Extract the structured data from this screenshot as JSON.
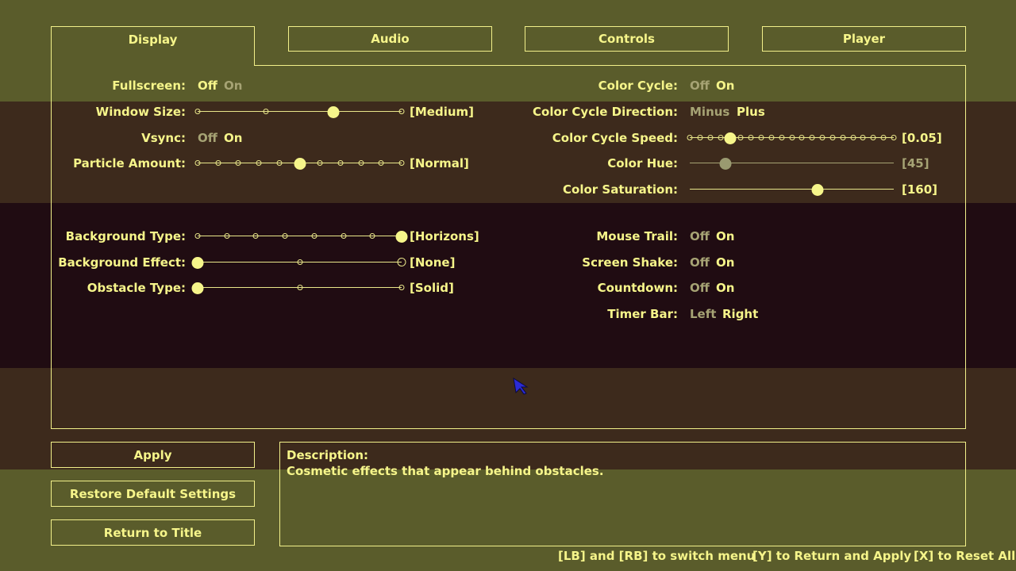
{
  "tabs": [
    "Display",
    "Audio",
    "Controls",
    "Player"
  ],
  "left": {
    "fullscreen": {
      "label": "Fullscreen:",
      "off": "Off",
      "on": "On",
      "selected": "off"
    },
    "window_size": {
      "label": "Window Size:",
      "value": "[Medium]",
      "positions": 4,
      "index": 2
    },
    "vsync": {
      "label": "Vsync:",
      "off": "Off",
      "on": "On",
      "selected": "on"
    },
    "particle_amount": {
      "label": "Particle Amount:",
      "value": "[Normal]",
      "positions": 11,
      "index": 5
    },
    "background_type": {
      "label": "Background Type:",
      "value": "[Horizons]",
      "positions": 8,
      "index": 7
    },
    "background_effect": {
      "label": "Background Effect:",
      "value": "[None]",
      "positions": 3,
      "index": 0
    },
    "obstacle_type": {
      "label": "Obstacle Type:",
      "value": "[Solid]",
      "positions": 3,
      "index": 0
    }
  },
  "right": {
    "color_cycle": {
      "label": "Color Cycle:",
      "off": "Off",
      "on": "On",
      "selected": "on"
    },
    "color_cycle_direction": {
      "label": "Color Cycle Direction:",
      "minus": "Minus",
      "plus": "Plus",
      "selected": "plus"
    },
    "color_cycle_speed": {
      "label": "Color Cycle Speed:",
      "value": "[0.05]",
      "positions": 21,
      "index": 4
    },
    "color_hue": {
      "label": "Color Hue:",
      "value": "[45]",
      "fraction": 0.176
    },
    "color_saturation": {
      "label": "Color Saturation:",
      "value": "[160]",
      "fraction": 0.627
    },
    "mouse_trail": {
      "label": "Mouse Trail:",
      "off": "Off",
      "on": "On",
      "selected": "on"
    },
    "screen_shake": {
      "label": "Screen Shake:",
      "off": "Off",
      "on": "On",
      "selected": "on"
    },
    "countdown": {
      "label": "Countdown:",
      "off": "Off",
      "on": "On",
      "selected": "on"
    },
    "timer_bar": {
      "label": "Timer Bar:",
      "left": "Left",
      "right": "Right",
      "selected": "right"
    }
  },
  "buttons": {
    "apply": "Apply",
    "restore": "Restore Default Settings",
    "return": "Return to Title"
  },
  "description": {
    "title": "Description:",
    "text": "Cosmetic effects that appear behind obstacles."
  },
  "hints": [
    "[LB] and [RB] to switch menu",
    "[Y] to Return and Apply",
    "[X] to Reset All."
  ],
  "colors": {
    "accent": "#f6f58a",
    "dim": "#a6a374",
    "band_olive": "#5a5c2b",
    "band_brown": "#3d2a1c",
    "band_dark": "#200c12"
  }
}
